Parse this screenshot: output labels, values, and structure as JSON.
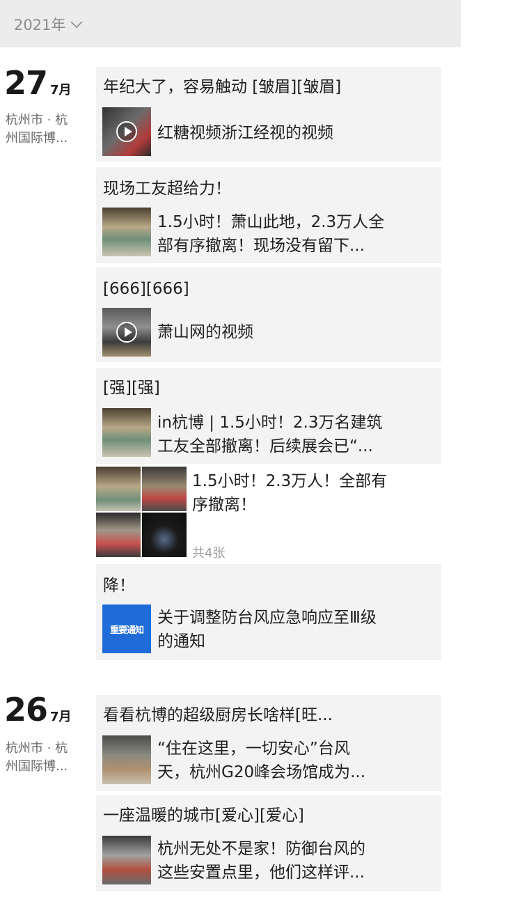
{
  "header": {
    "year": "2021年"
  },
  "days": [
    {
      "day": "27",
      "month": "7月",
      "location": [
        "杭州市 · 杭",
        "州国际博..."
      ]
    },
    {
      "day": "26",
      "month": "7月",
      "location": [
        "杭州市 · 杭",
        "州国际博..."
      ]
    }
  ],
  "posts": [
    {
      "text": "年纪大了，容易触动 [皱眉][皱眉]",
      "link": [
        "红糖视频浙江经视的视频"
      ],
      "video": true
    },
    {
      "text": "现场工友超给力！",
      "link": [
        "1.5小时！萧山此地，2.3万人全",
        "部有序撤离！现场没有留下..."
      ],
      "video": false
    },
    {
      "text": "[666][666]",
      "link": [
        "萧山网的视频"
      ],
      "video": true
    },
    {
      "text": "[强][强]",
      "link": [
        "in杭博 | 1.5小时！2.3万名建筑",
        "工友全部撤离！后续展会已“..."
      ],
      "video": false
    },
    {
      "text": "",
      "link": [
        "1.5小时！2.3万人！全部有",
        "序撤离！"
      ],
      "photo_count": "共4张"
    },
    {
      "text": "降！",
      "link": [
        "关于调整防台风应急响应至Ⅲ级",
        "的通知"
      ],
      "thumb_label": "重要通知"
    },
    {
      "text": "看看杭博的超级厨房长啥样[旺...",
      "link": [
        "“住在这里，一切安心”台风",
        "天，杭州G20峰会场馆成为..."
      ],
      "video": false
    },
    {
      "text": "一座温暖的城市[爱心][爱心]",
      "link": [
        "杭州无处不是家！防御台风的",
        "这些安置点里，他们这样评..."
      ],
      "video": false
    }
  ]
}
